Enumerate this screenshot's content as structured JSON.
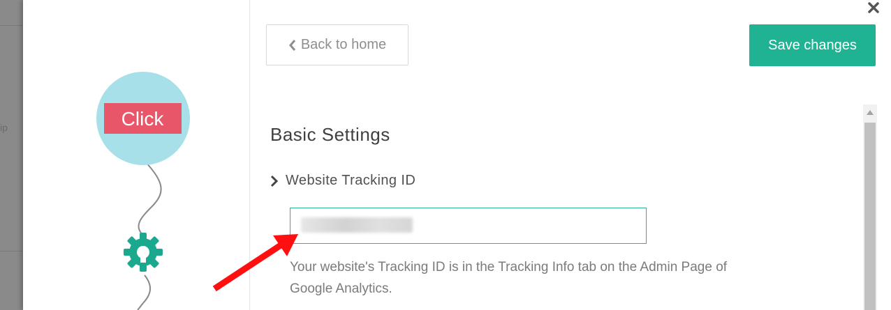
{
  "background": {
    "ghost_text": "ip"
  },
  "header": {
    "back_label": "Back to home",
    "save_label": "Save changes",
    "close_icon": "close-icon"
  },
  "flow": {
    "step_label": "Click",
    "icons": [
      "click-step",
      "gear-icon"
    ]
  },
  "settings": {
    "title": "Basic Settings",
    "field_label": "Website Tracking ID",
    "tracking_id_value": "",
    "help_text": "Your website's Tracking ID is in the Tracking Info tab on the Admin Page of Google Analytics."
  },
  "colors": {
    "accent": "#1fb393",
    "click_badge": "#e8566a",
    "bubble": "#a7e0e8",
    "arrow": "#ff1010"
  }
}
